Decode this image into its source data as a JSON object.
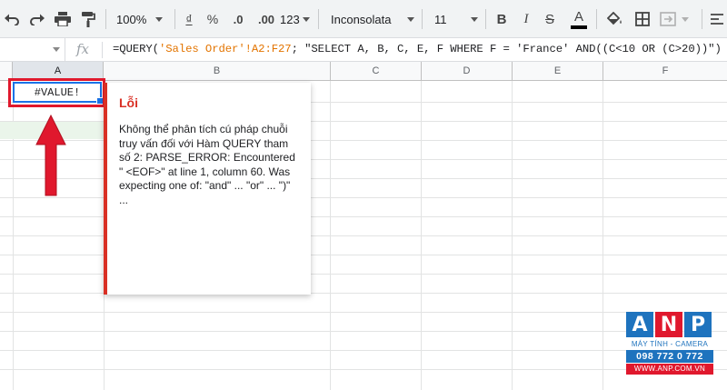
{
  "toolbar": {
    "zoom": "100%",
    "currency_symbol": "₫",
    "percent_symbol": "%",
    "decrease_decimal": ".0",
    "increase_decimal": ".00",
    "more_formats": "123",
    "font_family": "Inconsolata",
    "font_size": "11",
    "bold": "B",
    "italic": "I",
    "strikethrough": "S",
    "text_color": "A"
  },
  "formula_bar": {
    "fx": "fx",
    "formula_prefix": "=QUERY(",
    "formula_ref": "'Sales Order'!A2:F27",
    "formula_suffix": "; \"SELECT A, B, C, E, F WHERE F = 'France' AND((C<10 OR (C>20))\")"
  },
  "columns": [
    "A",
    "B",
    "C",
    "D",
    "E",
    "F"
  ],
  "cell_a1": {
    "value": "#VALUE!"
  },
  "error_tooltip": {
    "title": "Lỗi",
    "message": "Không thể phân tích cú pháp chuỗi truy vấn đối với Hàm QUERY tham số 2: PARSE_ERROR: Encountered \" <EOF>\" at line 1, column 60. Was expecting one of: \"and\" ... \"or\" ... \")\" ..."
  },
  "logo": {
    "letters": [
      "A",
      "N",
      "P"
    ],
    "tagline": "MÁY TÍNH - CAMERA",
    "phone": "098 772 0 772",
    "website": "WWW.ANP.COM.VN"
  },
  "colors": {
    "error_red": "#d93025",
    "selection_blue": "#1a73e8",
    "highlight_red": "#e0182d",
    "logo_blue": "#1e73be"
  }
}
